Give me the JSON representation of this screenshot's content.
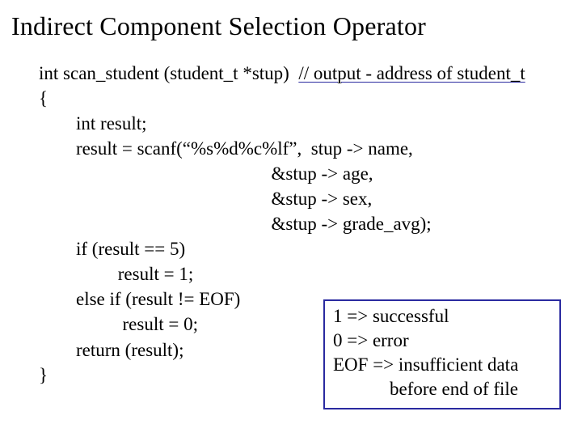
{
  "title": "Indirect Component Selection Operator",
  "code": {
    "sig_plain": "int scan_student (student_t *stup)  ",
    "sig_comment": "// output - address of student_t",
    "open_brace": "{",
    "l1": "        int result;",
    "l2": "        result = scanf(“%s%d%c%lf”,  stup -> name,",
    "l3": "                                                  &stup -> age,",
    "l4": "                                                  &stup -> sex,",
    "l5": "                                                  &stup -> grade_avg);",
    "l6": "        if (result == 5)",
    "l7": "                 result = 1;",
    "l8": "        else if (result != EOF)",
    "l9": "                  result = 0;",
    "l10": "        return (result);",
    "close_brace": "}"
  },
  "legend": {
    "r1": "1 => successful",
    "r2": "0 => error",
    "r3": "EOF => insufficient data",
    "r4": "before end of file"
  }
}
